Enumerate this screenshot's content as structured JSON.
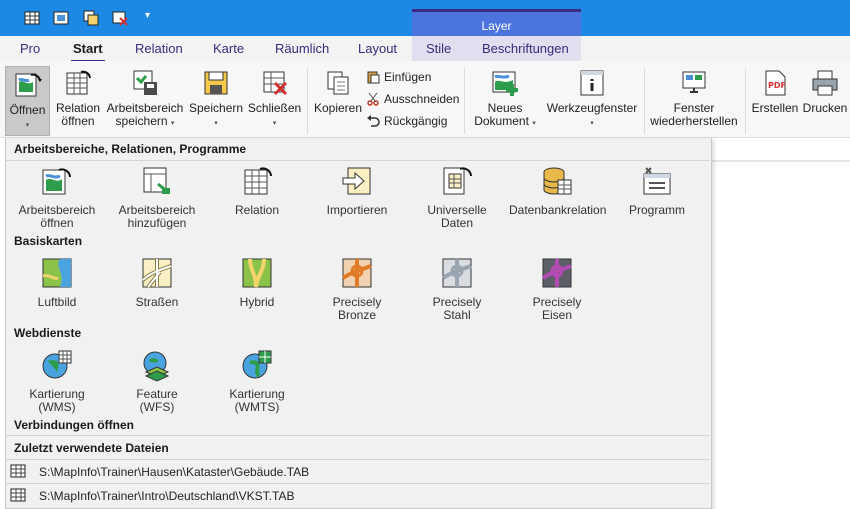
{
  "quick_access": {
    "icons": [
      "new-table-icon",
      "open-workspace-icon",
      "save-copy-icon",
      "close-table-icon",
      "customize-dropdown-icon"
    ]
  },
  "context_group": {
    "label": "Layer"
  },
  "tabs": [
    {
      "label": "Pro"
    },
    {
      "label": "Start"
    },
    {
      "label": "Relation"
    },
    {
      "label": "Karte"
    },
    {
      "label": "Räumlich"
    },
    {
      "label": "Layout"
    },
    {
      "label": "Stile"
    },
    {
      "label": "Beschriftungen"
    }
  ],
  "ribbon": {
    "open": {
      "line1": "Öffnen"
    },
    "relation_open": {
      "line1": "Relation",
      "line2": "öffnen"
    },
    "workspace_save": {
      "line1": "Arbeitsbereich",
      "line2": "speichern"
    },
    "save": {
      "line1": "Speichern"
    },
    "close": {
      "line1": "Schließen"
    },
    "copy": {
      "line1": "Kopieren"
    },
    "paste": {
      "label": "Einfügen"
    },
    "cut": {
      "label": "Ausschneiden"
    },
    "undo": {
      "label": "Rückgängig"
    },
    "new_document": {
      "line1": "Neues",
      "line2": "Dokument"
    },
    "tool_windows": {
      "line1": "Werkzeugfenster"
    },
    "restore_windows": {
      "line1": "Fenster",
      "line2": "wiederherstellen"
    },
    "export": {
      "line1": "Erstellen"
    },
    "print": {
      "line1": "Drucken"
    },
    "dropdown_glyph": "▾"
  },
  "menu": {
    "section_workspaces": "Arbeitsbereiche, Relationen, Programme",
    "workspaces_items": [
      {
        "line1": "Arbeitsbereich",
        "line2": "öffnen"
      },
      {
        "line1": "Arbeitsbereich",
        "line2": "hinzufügen"
      },
      {
        "line1": "Relation",
        "line2": ""
      },
      {
        "line1": "Importieren",
        "line2": ""
      },
      {
        "line1": "Universelle",
        "line2": "Daten"
      },
      {
        "line1": "Datenbankrelation",
        "line2": ""
      },
      {
        "line1": "Programm",
        "line2": ""
      }
    ],
    "section_basemaps": "Basiskarten",
    "basemap_items": [
      {
        "line1": "Luftbild",
        "line2": ""
      },
      {
        "line1": "Straßen",
        "line2": ""
      },
      {
        "line1": "Hybrid",
        "line2": ""
      },
      {
        "line1": "Precisely",
        "line2": "Bronze"
      },
      {
        "line1": "Precisely",
        "line2": "Stahl"
      },
      {
        "line1": "Precisely",
        "line2": "Eisen"
      }
    ],
    "section_webservices": "Webdienste",
    "webservice_items": [
      {
        "line1": "Kartierung",
        "line2": "(WMS)"
      },
      {
        "line1": "Feature",
        "line2": "(WFS)"
      },
      {
        "line1": "Kartierung",
        "line2": "(WMTS)"
      }
    ],
    "section_connections": "Verbindungen öffnen",
    "section_recent": "Zuletzt verwendete Dateien",
    "recent_files": [
      {
        "path": "S:\\MapInfo\\Trainer\\Hausen\\Kataster\\Gebäude.TAB"
      },
      {
        "path": "S:\\MapInfo\\Trainer\\Intro\\Deutschland\\VKST.TAB"
      }
    ]
  },
  "colors": {
    "title_bar": "#1e88e5",
    "context_group": "#4b74df",
    "accent": "#3d2a86",
    "menu_bg": "#f1f1f1"
  }
}
